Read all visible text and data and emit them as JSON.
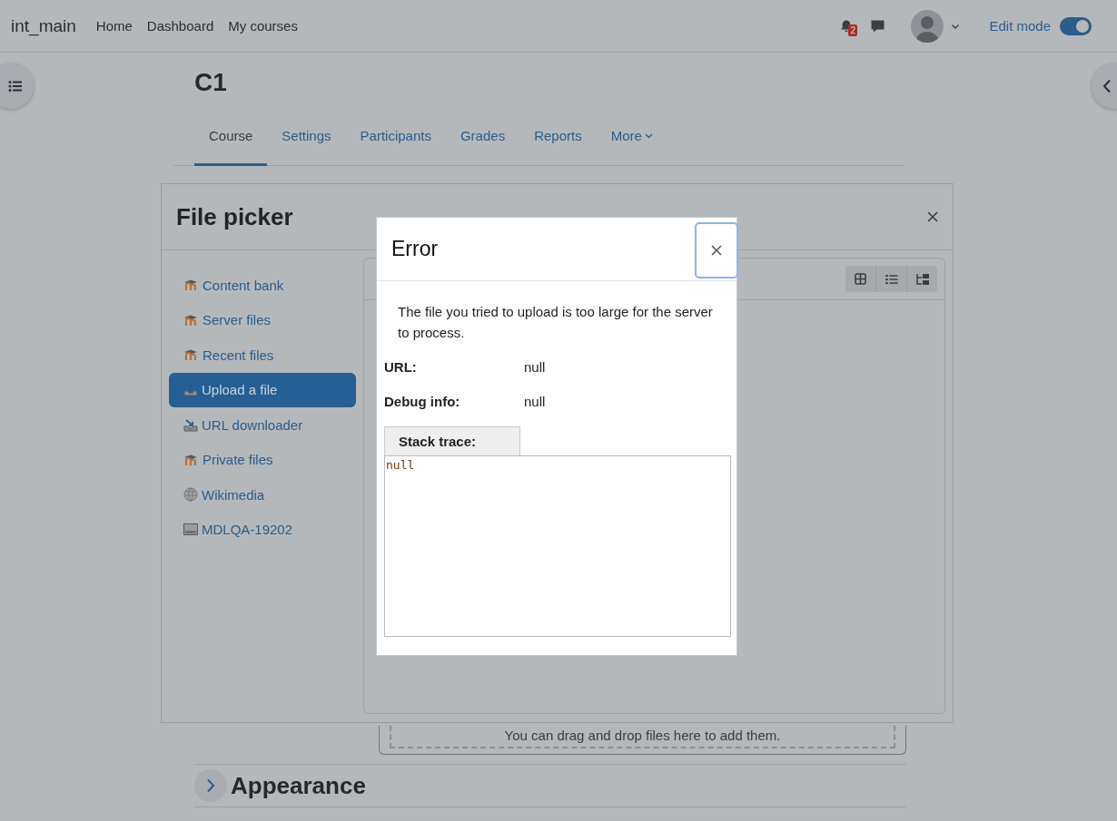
{
  "navbar": {
    "site_name": "int_main",
    "links": [
      "Home",
      "Dashboard",
      "My courses"
    ],
    "notification_count": "2",
    "edit_mode": {
      "label": "Edit mode",
      "on": true
    }
  },
  "course": {
    "title": "C1",
    "tabs": [
      {
        "label": "Course",
        "selected": true
      },
      {
        "label": "Settings",
        "selected": false
      },
      {
        "label": "Participants",
        "selected": false
      },
      {
        "label": "Grades",
        "selected": false
      },
      {
        "label": "Reports",
        "selected": false
      },
      {
        "label": "More",
        "selected": false
      }
    ]
  },
  "dropzone": {
    "text": "You can drag and drop files here to add them."
  },
  "section": {
    "title": "Appearance",
    "expanded": false
  },
  "file_picker": {
    "title": "File picker",
    "repositories": [
      {
        "label": "Content bank",
        "kind": "moodle",
        "selected": false
      },
      {
        "label": "Server files",
        "kind": "moodle",
        "selected": false
      },
      {
        "label": "Recent files",
        "kind": "moodle",
        "selected": false
      },
      {
        "label": "Upload a file",
        "kind": "upload",
        "selected": true
      },
      {
        "label": "URL downloader",
        "kind": "download",
        "selected": false
      },
      {
        "label": "Private files",
        "kind": "moodle",
        "selected": false
      },
      {
        "label": "Wikimedia",
        "kind": "wiki",
        "selected": false
      },
      {
        "label": "MDLQA-19202",
        "kind": "drive",
        "selected": false
      }
    ]
  },
  "error_dialog": {
    "title": "Error",
    "message": "The file you tried to upload is too large for the server to process.",
    "fields": [
      {
        "label": "URL:",
        "value": "null"
      },
      {
        "label": "Debug info:",
        "value": "null"
      }
    ],
    "stack_trace": {
      "label": "Stack trace:",
      "value": "null"
    }
  }
}
